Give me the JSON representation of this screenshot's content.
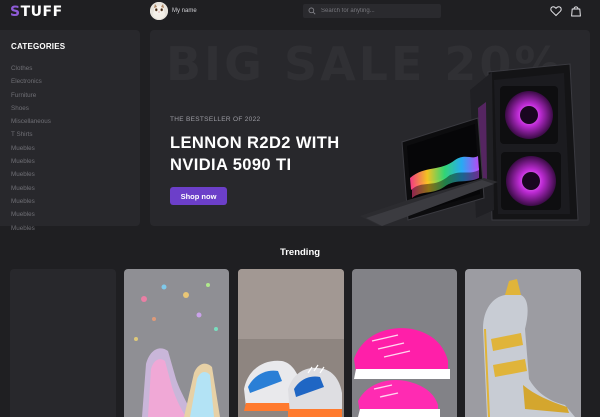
{
  "header": {
    "logo_prefix": "S",
    "logo_rest": "TUFF",
    "username": "My name",
    "search_placeholder": "Search for anyting..."
  },
  "sidebar": {
    "title": "CATEGORIES",
    "items": [
      {
        "label": "Clothes"
      },
      {
        "label": "Electronics"
      },
      {
        "label": "Furniture"
      },
      {
        "label": "Shoes"
      },
      {
        "label": "Miscellaneous"
      },
      {
        "label": "T Shirts"
      },
      {
        "label": "Muebles"
      },
      {
        "label": "Muebles"
      },
      {
        "label": "Muebles"
      },
      {
        "label": "Muebles"
      },
      {
        "label": "Muebles"
      },
      {
        "label": "Muebles"
      },
      {
        "label": "Muebles"
      }
    ]
  },
  "hero": {
    "background_text": "BIG SALE 20%",
    "subtitle": "THE BESTSELLER OF 2022",
    "title": "LENNON R2D2 WITH NVIDIA 5090 TI",
    "button_label": "Shop now"
  },
  "trending": {
    "title": "Trending"
  },
  "colors": {
    "background": "#1f1f22",
    "panel": "#28282c",
    "accent": "#6c3fc9",
    "logo_accent": "#8d5bd6",
    "muted_text": "#6f6f75"
  },
  "icons": {
    "search": "search-icon",
    "wishlist": "heart-icon",
    "cart": "shopping-bag-icon"
  }
}
